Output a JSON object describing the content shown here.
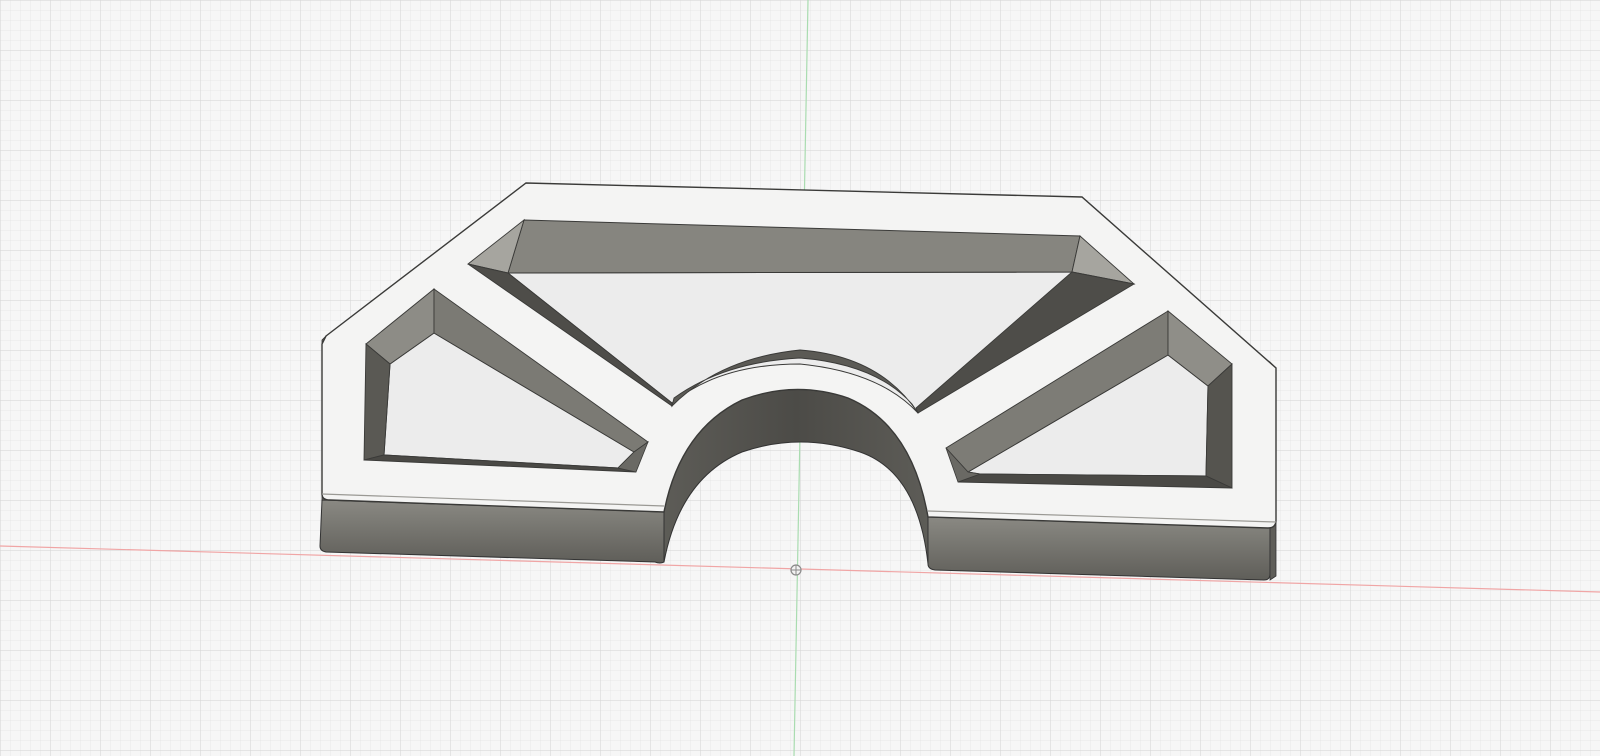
{
  "app": {
    "view": "3D viewport",
    "background_color": "#f6f6f6"
  },
  "scene": {
    "grid": "visible",
    "axis_colors": {
      "x_axis": "#ef9a9a",
      "y_axis": "#9fd9a8"
    },
    "origin_marker": "origin-point-icon",
    "model": {
      "body_top_color": "#f4f4f3",
      "body_side_color": "#6c6b66",
      "pocket_wall_color": "#7a7973",
      "pocket_floor_color": "#ececec",
      "edge_color": "#3a3a38",
      "pocket_count": 3
    }
  }
}
